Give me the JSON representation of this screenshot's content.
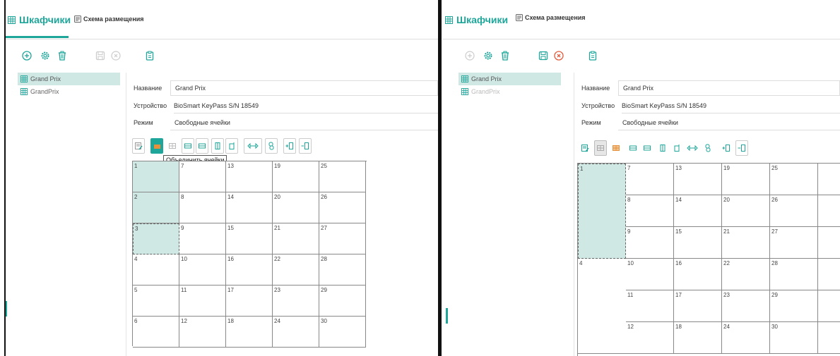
{
  "colors": {
    "accent": "#1ea69a",
    "selection": "#cfe8e4",
    "merge_icon": "#e8903c",
    "cancel": "#e25b3c"
  },
  "left": {
    "tab_title": "Шкафчики",
    "tab_second": "Схема размещения",
    "tree": [
      {
        "label": "Grand Prix"
      },
      {
        "label": "GrandPrix"
      }
    ],
    "form": {
      "name_label": "Название",
      "name_value": "Grand Prix",
      "device_label": "Устройство",
      "device_value": "BioSmart KeyPass S/N 18549",
      "mode_label": "Режим",
      "mode_value": "Свободные ячейки"
    },
    "tooltip": "Объединить ячейки",
    "cells": [
      "1",
      "2",
      "3",
      "4",
      "5",
      "6",
      "7",
      "8",
      "9",
      "10",
      "11",
      "12",
      "13",
      "14",
      "15",
      "16",
      "17",
      "18",
      "19",
      "20",
      "21",
      "22",
      "23",
      "24",
      "25",
      "26",
      "27",
      "28",
      "29",
      "30"
    ]
  },
  "right": {
    "tab_title": "Шкафчики",
    "tab_second": "Схема размещения",
    "tree": [
      {
        "label": "Grand Prix"
      },
      {
        "label": "GrandPrix"
      }
    ],
    "form": {
      "name_label": "Название",
      "name_value": "Grand Prix",
      "device_label": "Устройство",
      "device_value": "BioSmart KeyPass S/N 18549",
      "mode_label": "Режим",
      "mode_value": "Свободные ячейки"
    },
    "cells": [
      "1",
      "4",
      "7",
      "8",
      "9",
      "10",
      "11",
      "12",
      "13",
      "14",
      "15",
      "16",
      "17",
      "18",
      "19",
      "20",
      "21",
      "22",
      "23",
      "24",
      "25",
      "26",
      "27",
      "28",
      "29",
      "30"
    ]
  }
}
